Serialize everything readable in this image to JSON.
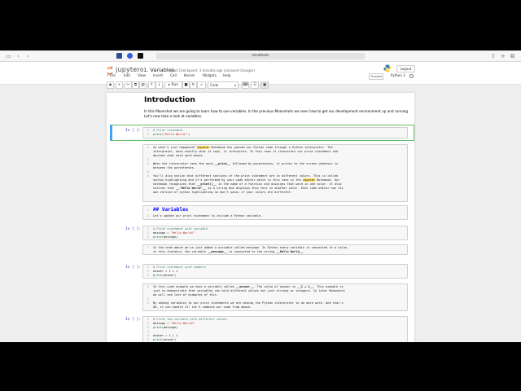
{
  "browser": {
    "url": "localhost"
  },
  "header": {
    "logo_text": "jupyter",
    "notebook_title": "01. Variables",
    "checkpoint": "Last Checkpoint: 3 minutes ago  (unsaved changes)",
    "logout_label": "Logout",
    "trusted_label": "Trusted",
    "kernel_name": "Python 3"
  },
  "menu": [
    "File",
    "Edit",
    "View",
    "Insert",
    "Cell",
    "Kernel",
    "Widgets",
    "Help"
  ],
  "toolbar": {
    "run_label": "▸ Run",
    "cell_type": "Code"
  },
  "cells": {
    "intro_heading": "Introduction",
    "intro_text_1": "In this Moonshot we are going to learn how to use variables. In the previous Moonshots we seen how to get our development environment up and running.",
    "intro_text_2": "Let's now take a look at variables.",
    "c1_prompt": "In [ ]:",
    "c1_l1": "# Print statement",
    "c1_l2_fn": "print",
    "c1_l2_str": "(\"Hello World!\")",
    "m1_l1a": "So what's just happened? ",
    "m1_l1b": "Jupyter",
    "m1_l1c": " Notebook has passed our Python code through a Python interpreter. The",
    "m1_l2": "interpreter, does exactly what it says, it interprets. In this case it interprets our print statement and",
    "m1_l3": "decides what each word means.",
    "m1_l5a": "When the interpreter sees the word ",
    "m1_l5b": "__print__",
    "m1_l5c": " followed by parentheses, it prints to the screen whatever is",
    "m1_l6": "between the parentheses.",
    "m1_l8": "You'll also notice that different sections of the print statement are in different colors. This is called",
    "m1_l9a": "syntax highlighting and it's performed by your code editor which in this case is the ",
    "m1_l9b": "Jupyter",
    "m1_l9c": " Notebook. Our",
    "m1_l10a": "notebook recognizes that ",
    "m1_l10b": "__print()__",
    "m1_l10c": " is the name of a function and displays that word in one color. It also",
    "m1_l11a": "notices that ",
    "m1_l11b": "__\"Hello World\"__",
    "m1_l11c": " is a string and displays this text in another color. Each code editor has its",
    "m1_l12": "own version of syntax highlighting so don't panic if your colors are different.",
    "m2_l1": "## Variables",
    "m2_l2": "Let's update our print statement to include a Python variable.",
    "c2_prompt": "In [ ]:",
    "c2_l1": "# Print statement with variable",
    "c2_l2a": "message = ",
    "c2_l2b": "\"Hello World!\"",
    "c2_l3a": "print",
    "c2_l3b": "(message)",
    "m3_l1": "In the code above we've just added a variable called message. In Python every variable is connected to a value,",
    "m3_l2a": "in this instance, the variable ",
    "m3_l2b": "__message__",
    "m3_l2c": " is connected to the string ",
    "m3_l2d": "__Hello World__",
    "m3_l2e": ".",
    "c3_prompt": "In [ ]:",
    "c3_l1": "# Print statement with numbers",
    "c3_l2": "answer = 1 + 1",
    "c3_l3a": "print",
    "c3_l3b": "(answer)",
    "m4_l1a": "In this code example we have a variable called ",
    "m4_l1b": "__answer__",
    "m4_l1c": ". The value of answer is ",
    "m4_l1d": "__1 + 1__",
    "m4_l1e": ". This example is",
    "m4_l2": "just to demonstrate that variables can hold different values not just strings or integers. In later Moonshots",
    "m4_l3": "we will see lots of examples of this.",
    "m4_l5": "By adding variables to our print statements we are asking the Python interpreter to do more work. And that's",
    "m4_l6": "OK, it can handle it! Let's combine our code from above.",
    "c4_prompt": "In [ ]:",
    "c4_l1": "# Print two variable with different values",
    "c4_l2a": "message = ",
    "c4_l2b": "\"Hello World!\"",
    "c4_l3a": "print",
    "c4_l3b": "(message)",
    "c4_l5": "answer = 1 + 1",
    "c4_l6a": "print",
    "c4_l6b": "(answer)"
  }
}
